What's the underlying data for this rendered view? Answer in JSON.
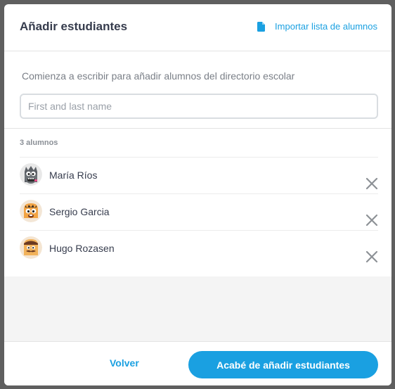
{
  "modal": {
    "title": "Añadir estudiantes",
    "import_label": "Importar lista de alumnos"
  },
  "search": {
    "instruction": "Comienza a escribir para añadir alumnos del directorio escolar",
    "placeholder": "First and last name",
    "value": ""
  },
  "students": {
    "count_label": "3 alumnos",
    "items": [
      {
        "name": "María Ríos",
        "avatar": "gray-monster-avatar"
      },
      {
        "name": "Sergio Garcia",
        "avatar": "orange-monster-avatar"
      },
      {
        "name": "Hugo Rozasen",
        "avatar": "mustache-monster-avatar"
      }
    ]
  },
  "footer": {
    "back_label": "Volver",
    "done_label": "Acabé de añadir estudiantes"
  },
  "colors": {
    "accent": "#1aa0e1",
    "text": "#363c4d",
    "muted": "#7a7f87",
    "overlay": "#5f5f5f"
  }
}
